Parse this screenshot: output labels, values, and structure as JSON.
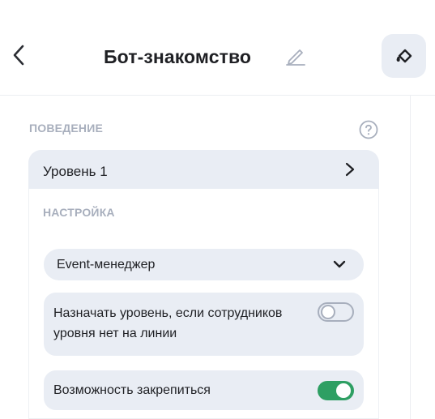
{
  "header": {
    "title": "Бот-знакомство",
    "back_icon": "chevron-left-icon",
    "edit_icon": "pencil-icon",
    "paint_icon": "paint-bucket-icon"
  },
  "behavior": {
    "section_title": "ПОВЕДЕНИЕ",
    "help_icon": "question-circle-icon",
    "level": {
      "label": "Уровень 1",
      "chevron_icon": "chevron-right-icon"
    },
    "settings": {
      "section_title": "НАСТРОЙКА",
      "event_select": {
        "value": "Event-менеджер",
        "chevron_icon": "chevron-down-icon"
      },
      "toggles": [
        {
          "label": "Назначать уровень, если сотрудников уровня нет на линии",
          "enabled": false
        },
        {
          "label": "Возможность закрепиться",
          "enabled": true
        }
      ]
    }
  },
  "colors": {
    "panel_background": "#e9edf4",
    "muted_text": "#a8afbd",
    "primary_text": "#1f2024",
    "toggle_on": "#2e9f63"
  }
}
